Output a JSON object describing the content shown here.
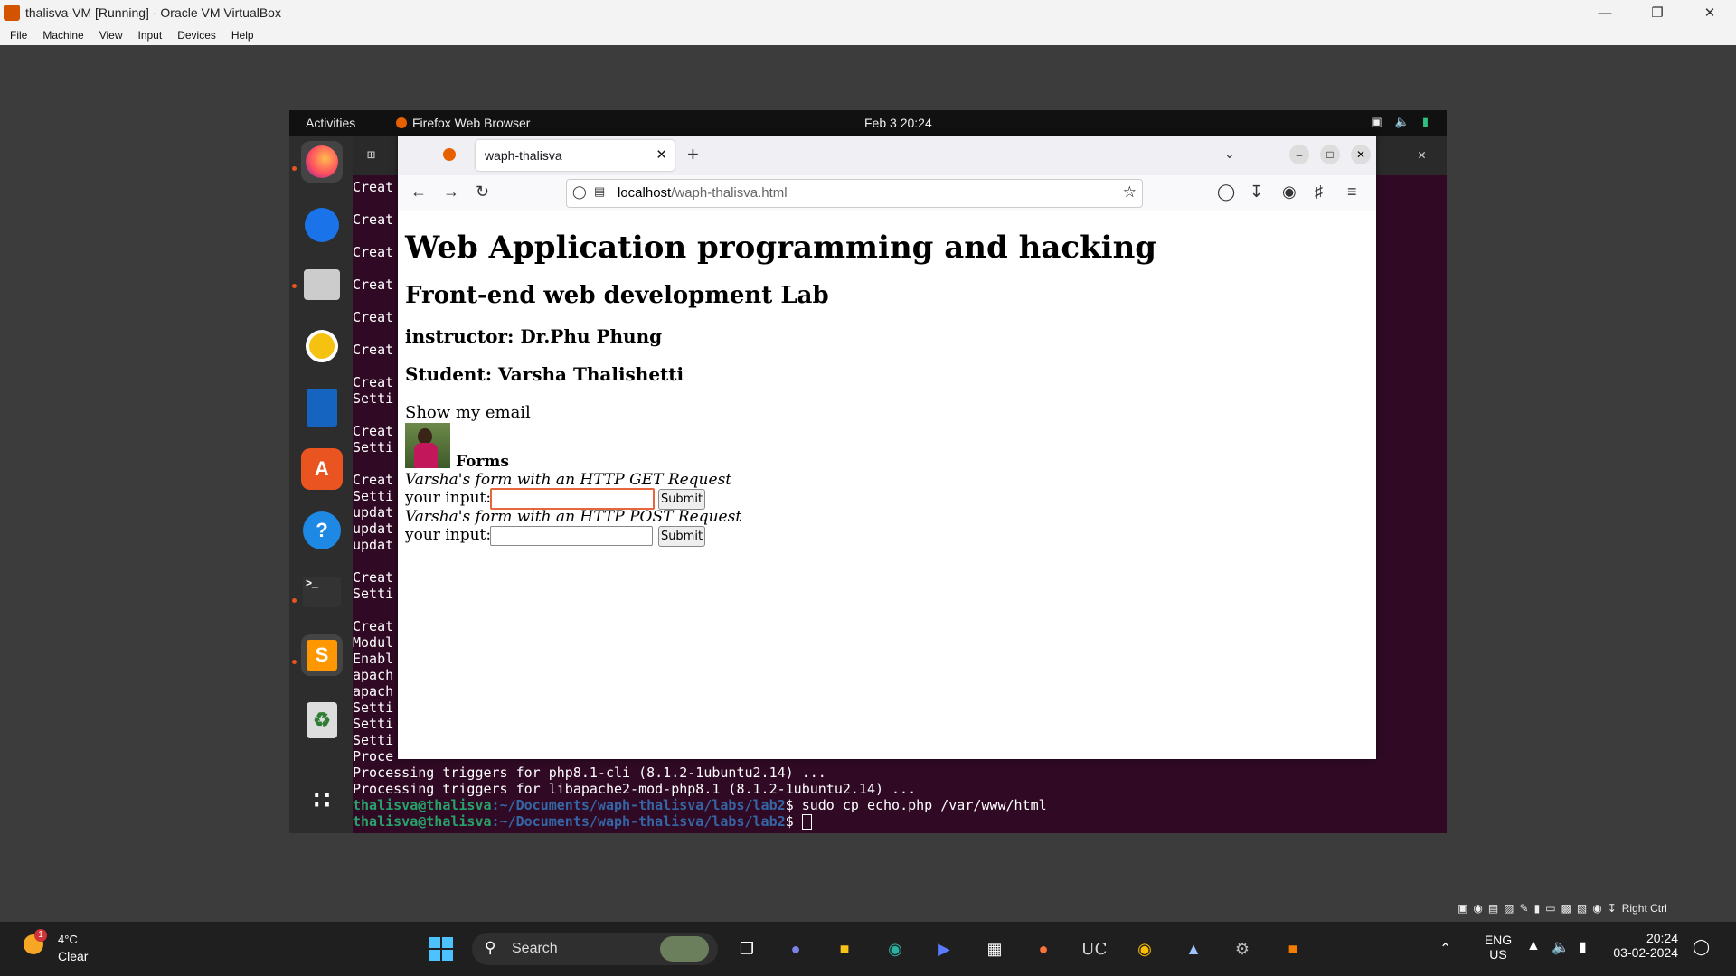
{
  "vbox": {
    "title": "thalisva-VM [Running] - Oracle VM VirtualBox",
    "menu": [
      "File",
      "Machine",
      "View",
      "Input",
      "Devices",
      "Help"
    ],
    "host_key": "Right Ctrl"
  },
  "ubuntu": {
    "activities": "Activities",
    "app_name": "Firefox Web Browser",
    "clock": "Feb 3  20:24"
  },
  "terminal": {
    "partial_lines": [
      "Creat",
      "Creat",
      "Creat",
      "Creat",
      "Creat",
      "Creat",
      "Creat",
      "Setti",
      "Creat",
      "Setti",
      "Creat",
      "Setti",
      "updat",
      "updat",
      "updat",
      "Creat",
      "Setti",
      "Creat",
      "Modul",
      "Enabl",
      "apach",
      "apach",
      "Setti",
      "Setti",
      "Setti",
      "Proce"
    ],
    "lines": [
      "Processing triggers for php8.1-cli (8.1.2-1ubuntu2.14) ...",
      "Processing triggers for libapache2-mod-php8.1 (8.1.2-1ubuntu2.14) ..."
    ],
    "prompt_user": "thalisva@thalisva",
    "prompt_path": ":~/Documents/waph-thalisva/labs/lab2",
    "command1": "$ sudo cp echo.php /var/www/html",
    "command2": "$ "
  },
  "firefox": {
    "tab_title": "waph-thalisva",
    "url_host": "localhost",
    "url_path": "/waph-thalisva.html"
  },
  "page": {
    "h1": "Web Application programming and hacking",
    "h2": "Front-end web development Lab",
    "instructor": "instructor: Dr.Phu Phung",
    "student": "Student: Varsha Thalishetti",
    "show_email": "Show my email",
    "forms_heading": "Forms",
    "get_caption": "Varsha's form with an HTTP GET Request",
    "post_caption": "Varsha's form with an HTTP POST Request",
    "input_label": "your input:",
    "submit_label": "Submit"
  },
  "taskbar": {
    "weather_temp": "4°C",
    "weather_desc": "Clear",
    "weather_badge": "1",
    "search": "Search",
    "lang1": "ENG",
    "lang2": "US",
    "time": "20:24",
    "date": "03-02-2024"
  }
}
